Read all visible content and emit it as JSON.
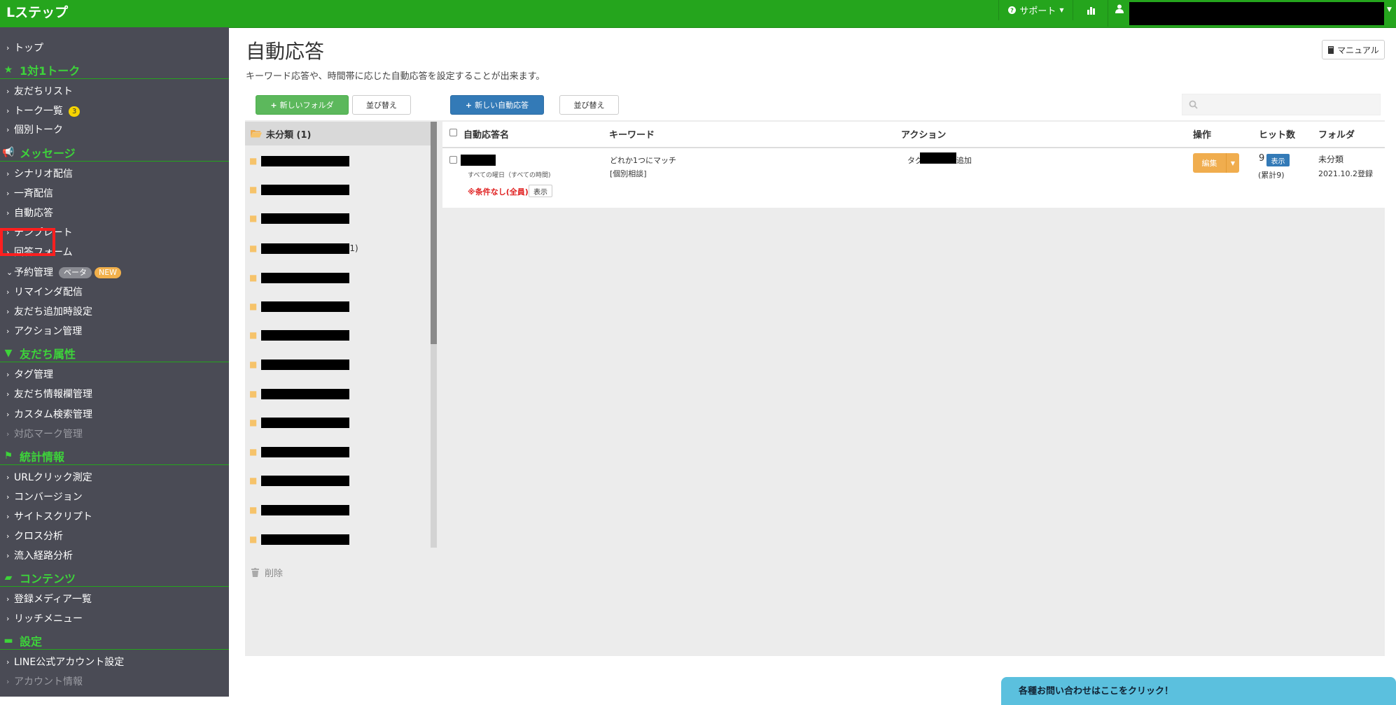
{
  "app": {
    "logo": "Lステップ"
  },
  "topbar": {
    "support_label": "サポート"
  },
  "sidebar": {
    "items": [
      {
        "label": "トップ"
      },
      {
        "label": "1対1トーク"
      },
      {
        "label": "友だちリスト"
      },
      {
        "label": "トーク一覧",
        "badge": "3"
      },
      {
        "label": "個別トーク"
      },
      {
        "label": "メッセージ"
      },
      {
        "label": "シナリオ配信"
      },
      {
        "label": "一斉配信"
      },
      {
        "label": "自動応答"
      },
      {
        "label": "テンプレート"
      },
      {
        "label": "回答フォーム"
      },
      {
        "label": "予約管理",
        "badge_beta": "ベータ",
        "badge_new": "NEW"
      },
      {
        "label": "リマインダ配信"
      },
      {
        "label": "友だち追加時設定"
      },
      {
        "label": "アクション管理"
      },
      {
        "label": "友だち属性"
      },
      {
        "label": "タグ管理"
      },
      {
        "label": "友だち情報欄管理"
      },
      {
        "label": "カスタム検索管理"
      },
      {
        "label": "対応マーク管理"
      },
      {
        "label": "統計情報"
      },
      {
        "label": "URLクリック測定"
      },
      {
        "label": "コンバージョン"
      },
      {
        "label": "サイトスクリプト"
      },
      {
        "label": "クロス分析"
      },
      {
        "label": "流入経路分析"
      },
      {
        "label": "コンテンツ"
      },
      {
        "label": "登録メディア一覧"
      },
      {
        "label": "リッチメニュー"
      },
      {
        "label": "設定"
      },
      {
        "label": "LINE公式アカウント設定"
      },
      {
        "label": "アカウント情報"
      }
    ]
  },
  "main": {
    "title": "自動応答",
    "description": "キーワード応答や、時間帯に応じた自動応答を設定することが出来ます。",
    "manual_label": "マニュアル",
    "new_folder_label": "新しいフォルダ",
    "sort_label": "並び替え",
    "new_autoreply_label": "新しい自動応答",
    "sort_label_2": "並び替え",
    "search_placeholder": ""
  },
  "folders": {
    "header": "未分類 (1)",
    "item_suffix_4": "1)",
    "delete_label": "削除"
  },
  "table": {
    "columns": [
      "自動応答名",
      "キーワード",
      "アクション",
      "操作",
      "ヒット数",
      "フォルダ"
    ],
    "row": {
      "schedule": "すべての曜日（すべての時間)",
      "condition": "※条件なし(全員)",
      "condition_show": "表示",
      "keyword_match": "どれか1つにマッチ",
      "keyword": "[個別相談]",
      "action_prefix": "タグ",
      "action_suffix": "追加",
      "edit_label": "編集",
      "hits": "9",
      "hits_show": "表示",
      "hits_total": "(累計9)",
      "folder": "未分類",
      "registered": "2021.10.2登録"
    }
  },
  "contact_bar": {
    "label": "各種お問い合わせはここをクリック！"
  },
  "colors": {
    "brand_green": "#25a51d",
    "sidebar_bg": "#4a4b55",
    "highlight_red": "#ff1f1f"
  }
}
